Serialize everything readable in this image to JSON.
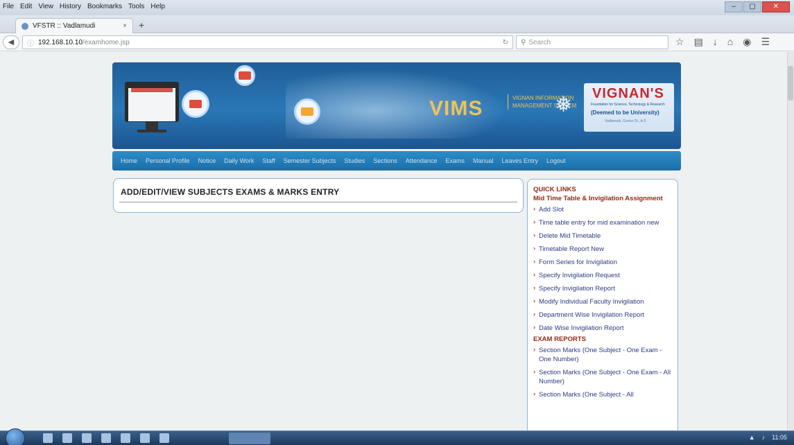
{
  "browser": {
    "menu": [
      "File",
      "Edit",
      "View",
      "History",
      "Bookmarks",
      "Tools",
      "Help"
    ],
    "tab_title": "VFSTR :: Vadlamudi",
    "tab_close": "×",
    "new_tab": "+",
    "url_host": "192.168.10.10",
    "url_path": "/examhome.jsp",
    "search_placeholder": "Search",
    "window_controls": [
      "–",
      "▢",
      "✕"
    ]
  },
  "banner": {
    "brand": "VIMS",
    "brand_subtitle": "VIGNAN INFORMATION MANAGEMENT SYSTEM",
    "university_name": "VIGNAN'S",
    "university_tagline": "Foundation for Science, Technology & Research",
    "university_status": "(Deemed to be University)",
    "university_address": "Vadlamudi, Guntur Dt., A.P."
  },
  "site_menu": [
    "Home",
    "Personal Profile",
    "Notice",
    "Daily Work",
    "Staff",
    "Semester Subjects",
    "Studies",
    "Sections",
    "Attendance",
    "Exams",
    "Manual",
    "Leaves Entry",
    "Logout"
  ],
  "main": {
    "title": "ADD/EDIT/VIEW SUBJECTS EXAMS & MARKS ENTRY"
  },
  "quick_links": {
    "heading": "QUICK LINKS",
    "section1_title": "Mid Time Table & Invigilation Assignment",
    "section1_items": [
      "Add Slot",
      "Time table entry for mid examination new",
      "Delete Mid Timetable",
      "Timetable Report New",
      "Form Series for Invigilation",
      "Specify Invigilation Request",
      "Specify Invigilation Report",
      "Modify Individual Faculty Invigilation",
      "Department Wise Invigilation Report",
      "Date Wise Invigilation Report"
    ],
    "section2_title": "EXAM REPORTS",
    "section2_items": [
      "Section Marks (One Subject - One Exam - One Number)",
      "Section Marks (One Subject - One Exam - All Number)",
      "Section Marks (One Subject - All"
    ]
  },
  "taskbar": {
    "clock": "11:05"
  }
}
